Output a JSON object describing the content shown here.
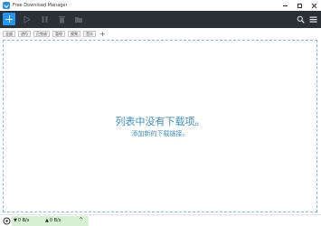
{
  "window": {
    "title": "Free Download Manager"
  },
  "tabs": [
    "全部",
    "进行",
    "已完成",
    "暂停",
    "视频",
    "音乐"
  ],
  "empty_state": {
    "message": "列表中没有下载项。",
    "link": "添加新的下载链接。"
  },
  "status": {
    "download_speed": "0 B/s",
    "upload_speed": "0 B/s"
  },
  "colors": {
    "toolbar_bg": "#2b2f36",
    "accent": "#2196f3",
    "empty_text": "#3a8fc4",
    "status_bg": "#d7efd2"
  }
}
